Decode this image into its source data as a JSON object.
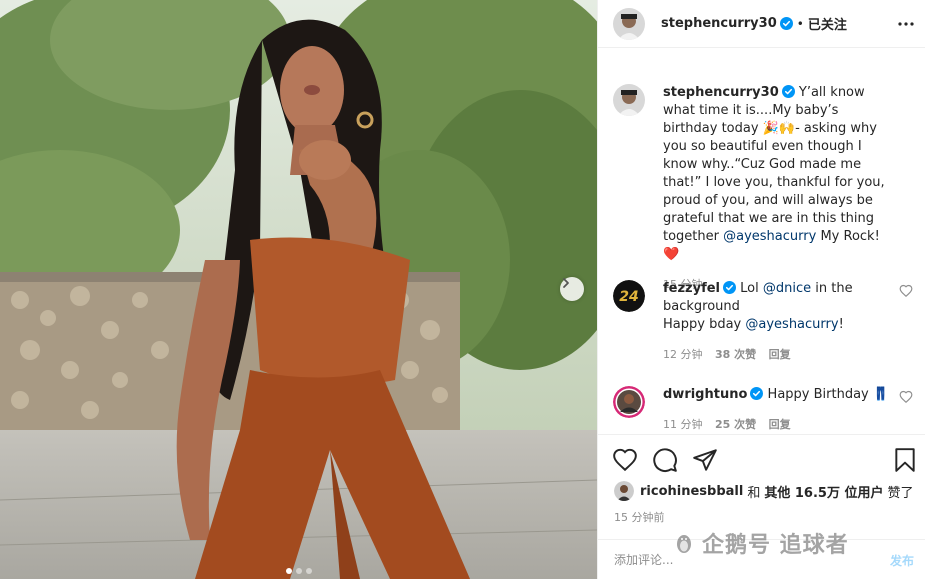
{
  "post": {
    "author": "stephencurry30",
    "follow_state": "已关注",
    "separator": "•"
  },
  "caption": {
    "username": "stephencurry30",
    "text_1": "Y’all know what time it is....My baby’s birthday today",
    "emoji_1": "🎉🙌",
    "text_2": "- asking why you so beautiful even though I know why..“Cuz God made me that!” I love you, thankful for you, proud of you, and will always be grateful that we are in this thing together",
    "mention": "@ayeshacurry",
    "text_3": "My Rock!",
    "emoji_2": "❤️",
    "time": "15 分钟"
  },
  "comments": [
    {
      "username": "fezzyfel",
      "text_1": "Lol",
      "mention_1": "@dnice",
      "text_2": "in the background",
      "text_3": "Happy bday",
      "mention_2": "@ayeshacurry",
      "text_4": "!",
      "time": "12 分钟",
      "likes": "38 次赞",
      "reply": "回复"
    },
    {
      "username": "dwrightuno",
      "text_1": "Happy Birthday",
      "emoji": "👖",
      "time": "11 分钟",
      "likes": "25 次赞",
      "reply": "回复"
    }
  ],
  "likes_line": {
    "user": "ricohinesbball",
    "middle": "和",
    "others": "其他 16.5万 位用户",
    "suffix": "赞了"
  },
  "timestamp": "15 分钟前",
  "add_comment": {
    "placeholder": "添加评论...",
    "post_label": "发布"
  },
  "watermark": "企鹅号 追球者",
  "carousel": {
    "total": 3,
    "active": 1
  },
  "colors": {
    "verified": "#0095f6",
    "mention": "#00376b",
    "heart": "#ed4956",
    "muted": "#8e8e8e"
  }
}
